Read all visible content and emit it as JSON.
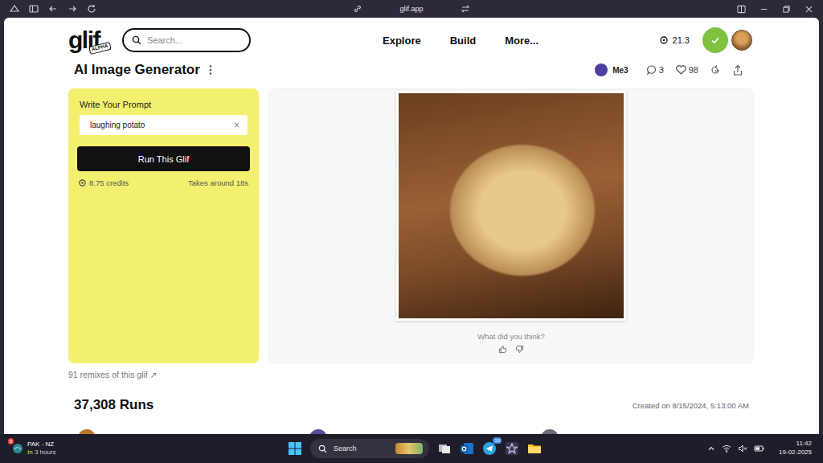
{
  "browser": {
    "url": "glif.app"
  },
  "header": {
    "logo": "glif",
    "logo_badge": "ALPHA",
    "search_placeholder": "Search...",
    "nav": [
      "Explore",
      "Build",
      "More..."
    ],
    "credits": "21.3"
  },
  "glif": {
    "title": "AI Image Generator",
    "author": "Me3",
    "comments": "3",
    "likes": "98"
  },
  "prompt": {
    "label": "Write Your Prompt",
    "value": "laughing potato",
    "clear": "×",
    "button": "Run This Glif",
    "cost": "8.75 credits",
    "duration": "Takes around 18s"
  },
  "result": {
    "feedback": "What did you think?"
  },
  "remixes": {
    "label": "91 remixes of this glif",
    "arrow": "↗"
  },
  "runs": "37,308 Runs",
  "created": "Created on 8/15/2024, 5:13:00 AM",
  "taskbar": {
    "weather": {
      "title": "PAK - NZ",
      "subtitle": "In 3 hours",
      "badge": "5"
    },
    "search": "Search",
    "app_badge": "10",
    "clock": {
      "time": "11:42",
      "date": "19-02-2025"
    }
  }
}
